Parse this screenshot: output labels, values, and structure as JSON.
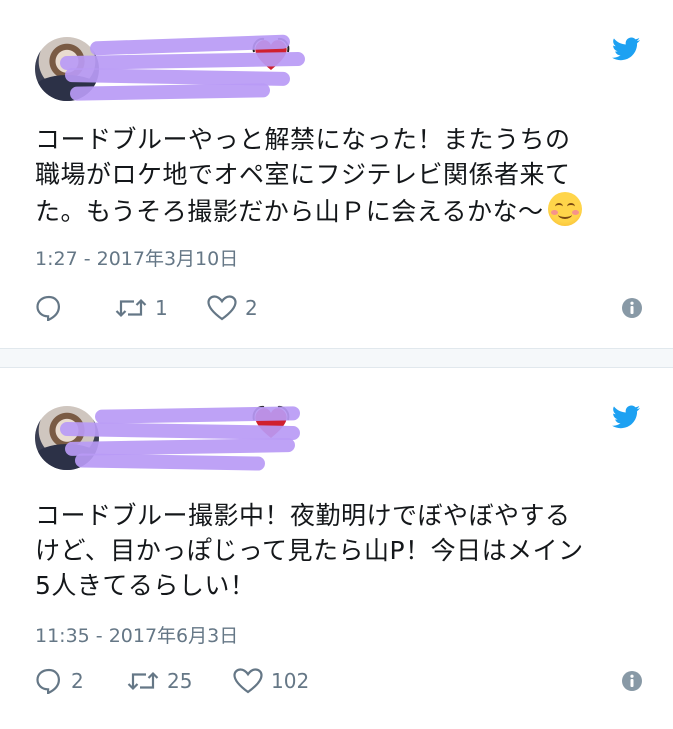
{
  "tweets": [
    {
      "text_lines": [
        "コードブルーやっと解禁になった！またうちの",
        "職場がロケ地でオペ室にフジテレビ関係者来て",
        "た。もうそろ撮影だから山Ｐに会えるかな〜"
      ],
      "emoji": "smiling-face-icon",
      "timestamp": "1:27 - 2017年3月10日",
      "reply_count": "",
      "retweet_count": "1",
      "like_count": "2"
    },
    {
      "text_lines": [
        "コードブルー撮影中！夜勤明けでぼやぼやする",
        "けど、目かっぽじって見たら山P！今日はメイン",
        "5人きてるらしい！"
      ],
      "timestamp": "11:35 - 2017年6月3日",
      "reply_count": "2",
      "retweet_count": "25",
      "like_count": "102"
    }
  ],
  "colors": {
    "twitter_blue": "#1da1f2",
    "meta_gray": "#657786",
    "text": "#14171a",
    "redaction": "#b99af5"
  }
}
